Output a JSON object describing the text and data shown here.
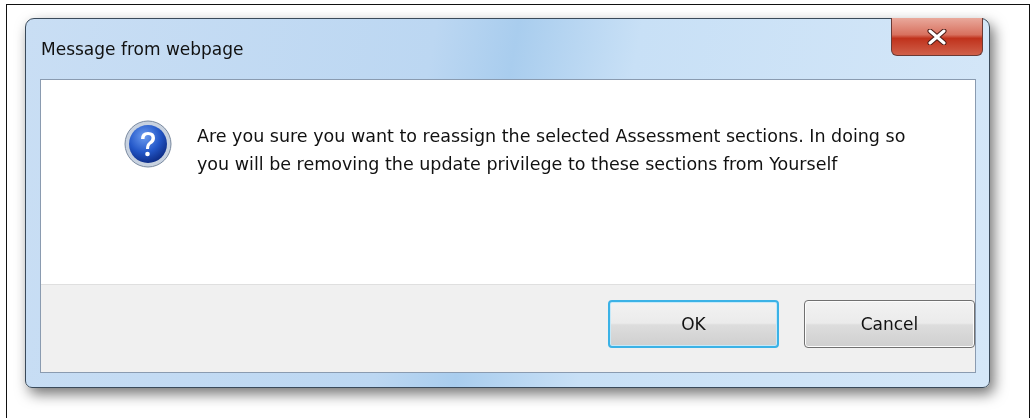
{
  "window": {
    "title": "Message from webpage"
  },
  "message": {
    "text": "Are you sure you want to reassign the selected Assessment sections. In doing so you will be removing the update privilege to these sections from Yourself"
  },
  "buttons": [
    {
      "label": "OK",
      "default": true
    },
    {
      "label": "Cancel",
      "default": false
    }
  ]
}
